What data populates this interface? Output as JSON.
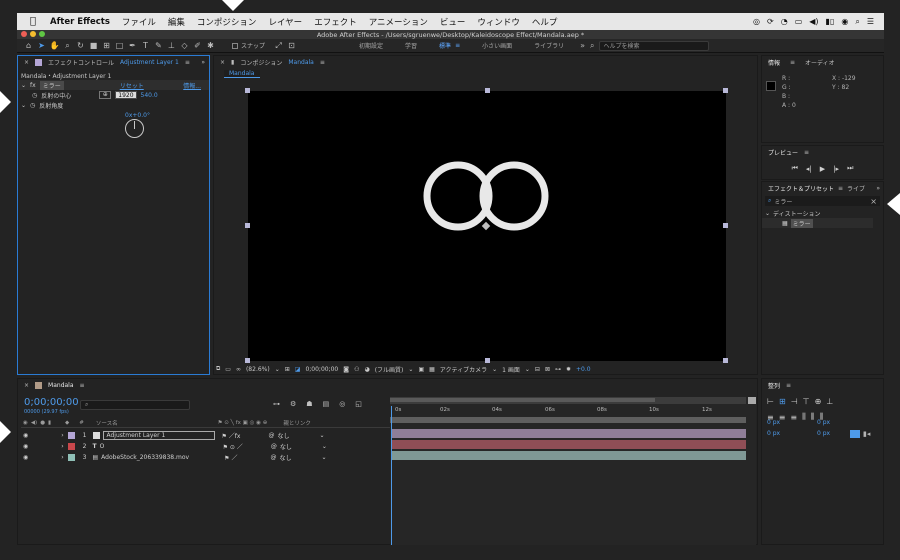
{
  "menubar": {
    "app": "After Effects",
    "items": [
      "ファイル",
      "編集",
      "コンポジション",
      "レイヤー",
      "エフェクト",
      "アニメーション",
      "ビュー",
      "ウィンドウ",
      "ヘルプ"
    ]
  },
  "window": {
    "title": "Adobe After Effects - /Users/sgruenwe/Desktop/Kaleidoscope Effect/Mandala.aep *"
  },
  "toolbar": {
    "snap_label": "スナップ",
    "workspaces": [
      "初期設定",
      "学習",
      "標準",
      "小さい画面",
      "ライブラリ"
    ],
    "active_workspace": 2,
    "search_placeholder": "ヘルプを検索"
  },
  "effect_controls": {
    "tab_prefix": "エフェクトコントロール",
    "tab_layer": "Adjustment Layer 1",
    "header": "Mandala・Adjustment Layer 1",
    "effect_name": "ミラー",
    "reset": "リセット",
    "about": "情報...",
    "prop1_label": "反射の中心",
    "prop1_x": "1920",
    "prop1_y": "540.0",
    "prop2_label": "反射角度",
    "prop2_value": "0x+0.0°"
  },
  "composition": {
    "tab_prefix": "コンポジション",
    "tab_name": "Mandala",
    "breadcrumb": "Mandala",
    "zoom": "(82.6%)",
    "timecode": "0;00;00;00",
    "resolution": "(フル画質)",
    "camera": "アクティブカメラ",
    "views": "1 画面",
    "exposure": "+0.0"
  },
  "info": {
    "tab": "情報",
    "tab2": "オーディオ",
    "r": "R :",
    "g": "G :",
    "b": "B :",
    "a": "A : 0",
    "x": "X : -129",
    "y": "Y : 82"
  },
  "preview": {
    "tab": "プレビュー"
  },
  "effects_presets": {
    "tab": "エフェクト＆プリセット",
    "tab2": "ライブ",
    "search_value": "ミラー",
    "category": "ディストーション",
    "result": "ミラー"
  },
  "timeline": {
    "comp_name": "Mandala",
    "timecode": "0;00;00;00",
    "timecode_sub": "00000 (29.97 fps)",
    "col_source": "ソース名",
    "col_parent": "親とリンク",
    "ruler": [
      "0s",
      "02s",
      "04s",
      "06s",
      "08s",
      "10s",
      "12s"
    ],
    "layers": [
      {
        "num": "1",
        "name": "Adjustment Layer 1",
        "color": "#b4a6d6",
        "parent": "なし",
        "bar_color": "#8f7e98"
      },
      {
        "num": "2",
        "name": "O",
        "color": "#c9474b",
        "parent": "なし",
        "bar_color": "#8f4e56"
      },
      {
        "num": "3",
        "name": "AdobeStock_206339838.mov",
        "color": "#8fbfb6",
        "parent": "なし",
        "bar_color": "#7f9895"
      }
    ]
  },
  "align": {
    "tab": "整列",
    "px1": "0 px",
    "px2": "0 px",
    "px3": "0 px",
    "px4": "0 px"
  }
}
